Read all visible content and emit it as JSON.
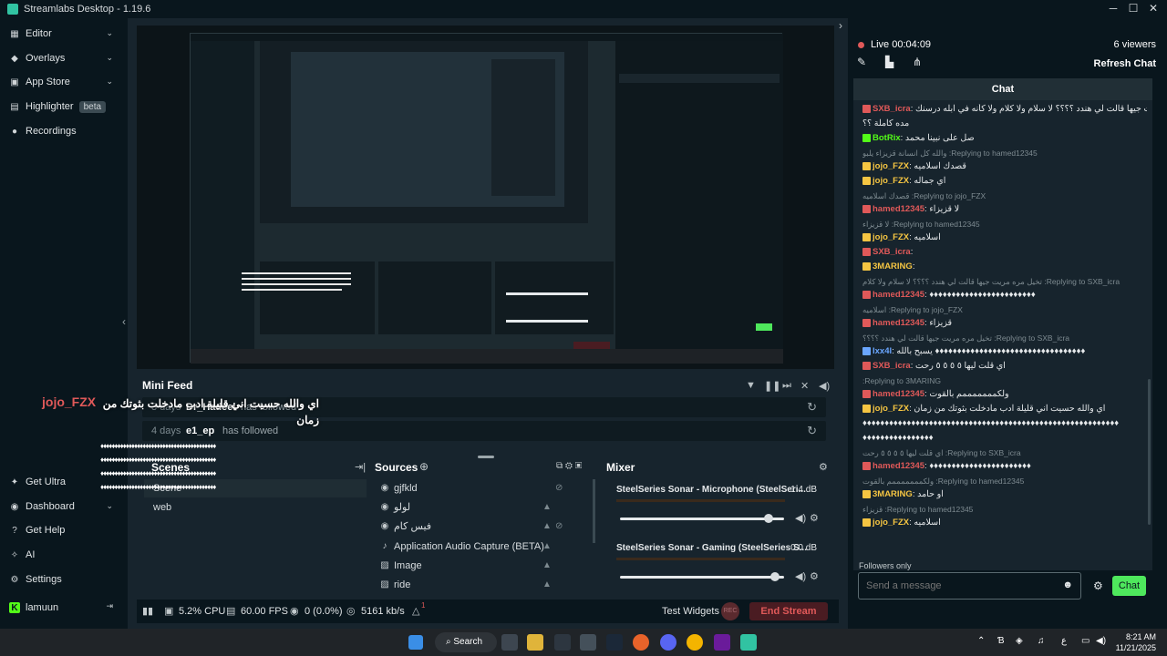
{
  "titlebar": {
    "title": "Streamlabs Desktop - 1.19.6",
    "minimize": "─",
    "maximize": "☐",
    "close": "✕"
  },
  "sidebar": {
    "items": [
      {
        "label": "Editor",
        "icon": "editor-icon"
      },
      {
        "label": "Overlays",
        "icon": "overlays-icon"
      },
      {
        "label": "App Store",
        "icon": "app-store-icon"
      },
      {
        "label": "Highlighter",
        "badge": "beta",
        "icon": "highlighter-icon"
      },
      {
        "label": "Recordings",
        "icon": "recordings-icon"
      }
    ],
    "bottom": [
      {
        "label": "Get Ultra",
        "icon": "ultra-icon"
      },
      {
        "label": "Dashboard",
        "icon": "dashboard-icon"
      },
      {
        "label": "Get Help",
        "icon": "help-icon"
      },
      {
        "label": "AI",
        "icon": "ai-icon"
      },
      {
        "label": "Settings",
        "icon": "gear-icon"
      },
      {
        "label": "lamuun",
        "icon": "kick-icon"
      }
    ]
  },
  "minifeed": {
    "title": "Mini Feed",
    "rows": [
      {
        "days": "3 days",
        "user": "Dr_Hadeel",
        "action": "has followed"
      },
      {
        "days": "4 days",
        "user": "e1_ep",
        "action": "has followed"
      }
    ]
  },
  "overlay": {
    "user": "jojo_FZX",
    "message": "اي والله حسيت اني قليلة ادب مادخلت بثوتك من زمان",
    "deco1": "♦♦♦♦♦♦♦♦♦♦♦♦♦♦♦♦♦♦♦♦♦♦♦♦♦♦♦♦♦♦♦♦♦♦♦♦♦♦♦♦♦",
    "deco2": "♦♦♦♦♦♦♦♦♦♦♦♦♦♦♦♦♦♦♦♦♦♦♦♦♦♦♦♦♦♦♦♦♦♦♦♦♦♦♦♦♦",
    "deco3": "♦♦♦♦♦♦♦♦♦♦♦♦♦♦♦♦♦♦♦♦♦♦♦♦♦♦♦♦♦♦♦♦♦♦♦♦♦♦♦♦♦",
    "deco4": "♦♦♦♦♦♦♦♦♦♦♦♦♦♦♦♦♦♦♦♦♦♦♦♦♦♦♦♦♦♦♦♦♦♦♦♦♦♦♦♦♦"
  },
  "scenes": {
    "title": "Scenes",
    "items": [
      "Scene",
      "web"
    ]
  },
  "sources": {
    "title": "Sources",
    "items": [
      {
        "name": "gjfkld",
        "icon": "eye-icon"
      },
      {
        "name": "لولو",
        "icon": "eye-icon"
      },
      {
        "name": "فيس كام",
        "icon": "eye-icon"
      },
      {
        "name": "Application Audio Capture (BETA)",
        "icon": "audio-icon"
      },
      {
        "name": "Image",
        "icon": "image-icon"
      },
      {
        "name": "ride",
        "icon": "image-icon"
      }
    ]
  },
  "mixer": {
    "title": "Mixer",
    "channels": [
      {
        "name": "SteelSeries Sonar - Microphone (SteelSeri...",
        "db": "-1.4 dB",
        "level": 0.93
      },
      {
        "name": "SteelSeries Sonar - Gaming (SteelSeries S...",
        "db": "0.0 dB",
        "level": 0.97
      }
    ]
  },
  "status": {
    "cpu": "5.2% CPU",
    "fps": "60.00 FPS",
    "dropped": "0 (0.0%)",
    "bitrate": "5161 kb/s",
    "alerts": "1",
    "test_widgets": "Test Widgets",
    "rec": "REC",
    "end_stream": "End Stream"
  },
  "chat": {
    "live": "Live 00:04:09",
    "viewers": "6 viewers",
    "refresh": "Refresh Chat",
    "header": "Chat",
    "followers_only": "Followers only",
    "input_placeholder": "Send a message",
    "send": "Chat",
    "colors": {
      "red": "#e05959",
      "green": "#53fc18",
      "orange": "#f5c542",
      "blue": "#6aa6ff"
    },
    "lines": [
      {
        "type": "msg",
        "user": "SXB_icra",
        "color": "#e05959",
        "text": "تخيل مره مريت جيها قالت لي هندد ؟؟؟؟ لا سلام ولا كلام ولا كأنه في ابله درسنك"
      },
      {
        "type": "cont",
        "text": "مده كاملة ؟؟"
      },
      {
        "type": "msg",
        "user": "BotRix",
        "color": "#53fc18",
        "text": "صل على نبينا محمد"
      },
      {
        "type": "reply",
        "text": "Replying to hamed12345: والله كل انسانة قزيزاء يلبو"
      },
      {
        "type": "msg",
        "user": "jojo_FZX",
        "color": "#f5c542",
        "text": "قصدك اسلاميه"
      },
      {
        "type": "msg",
        "user": "jojo_FZX",
        "color": "#f5c542",
        "text": "اي جماله"
      },
      {
        "type": "reply",
        "text": "Replying to jojo_FZX: قصدك اسلاميه"
      },
      {
        "type": "msg",
        "user": "hamed12345",
        "color": "#e05959",
        "text": "لا قزيزاء"
      },
      {
        "type": "reply",
        "text": "Replying to hamed12345: لا قزيزاء"
      },
      {
        "type": "msg",
        "user": "jojo_FZX",
        "color": "#f5c542",
        "text": "اسلاميه"
      },
      {
        "type": "msg",
        "user": "SXB_icra",
        "color": "#e05959",
        "text": ""
      },
      {
        "type": "msg",
        "user": "3MARING",
        "color": "#f5c542",
        "text": ""
      },
      {
        "type": "reply",
        "text": "Replying to SXB_icra: تخيل مره مريت جيها قالت لي هندد ؟؟؟؟ لا سلام ولا كلام"
      },
      {
        "type": "msg",
        "user": "hamed12345",
        "color": "#e05959",
        "text": "♦♦♦♦♦♦♦♦♦♦♦♦♦♦♦♦♦♦♦♦♦♦♦♦"
      },
      {
        "type": "reply",
        "text": "Replying to jojo_FZX: اسلاميه"
      },
      {
        "type": "msg",
        "user": "hamed12345",
        "color": "#e05959",
        "text": "قزيزاء"
      },
      {
        "type": "reply",
        "text": "Replying to SXB_icra: تخيل مره مريت جيها قالت لي هندد ؟؟؟؟"
      },
      {
        "type": "msg",
        "user": "lxx4l",
        "color": "#6aa6ff",
        "text": "♦♦♦♦♦♦♦♦♦♦♦♦♦♦♦♦♦♦♦♦♦♦♦♦♦♦♦♦♦♦♦♦♦♦ يسبح بالله"
      },
      {
        "type": "msg",
        "user": "SXB_icra",
        "color": "#e05959",
        "text": "اي قلت ليها ٥ ٥ ٥ ٥ رحت"
      },
      {
        "type": "reply",
        "text": "Replying to 3MARING:"
      },
      {
        "type": "msg",
        "user": "hamed12345",
        "color": "#e05959",
        "text": "ولكمممممممم بالقوت"
      },
      {
        "type": "msg",
        "user": "jojo_FZX",
        "color": "#f5c542",
        "text": "اي والله حسيت اني قليلة ادب مادخلت بثوتك من زمان"
      },
      {
        "type": "cont",
        "text": "♦♦♦♦♦♦♦♦♦♦♦♦♦♦♦♦♦♦♦♦♦♦♦♦♦♦♦♦♦♦♦♦♦♦♦♦♦♦♦♦♦♦♦♦♦♦♦♦♦♦♦♦♦♦♦♦♦♦"
      },
      {
        "type": "cont",
        "text": "♦♦♦♦♦♦♦♦♦♦♦♦♦♦♦♦"
      },
      {
        "type": "reply",
        "text": "Replying to SXB_icra: اي قلت ليها ٥ ٥ ٥ ٥ رحت"
      },
      {
        "type": "msg",
        "user": "hamed12345",
        "color": "#e05959",
        "text": "♦♦♦♦♦♦♦♦♦♦♦♦♦♦♦♦♦♦♦♦♦♦♦"
      },
      {
        "type": "reply",
        "text": "Replying to hamed12345: ولكمممممممم بالقوت"
      },
      {
        "type": "msg",
        "user": "3MARING",
        "color": "#f5c542",
        "text": "او حامد"
      },
      {
        "type": "reply",
        "text": "Replying to hamed12345: قزيزاء"
      },
      {
        "type": "msg",
        "user": "jojo_FZX",
        "color": "#f5c542",
        "text": "اسلاميه"
      }
    ]
  },
  "taskbar": {
    "search": "Search",
    "time": "8:21 AM",
    "date": "11/21/2025",
    "lang": "ع"
  }
}
